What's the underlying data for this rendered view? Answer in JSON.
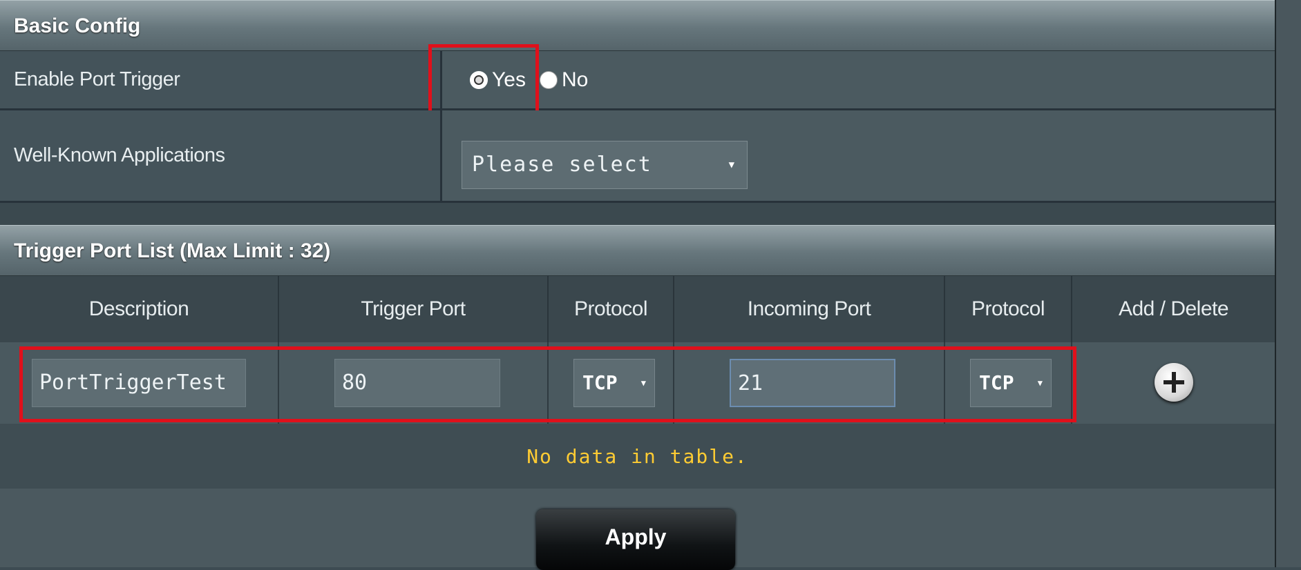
{
  "basic_config": {
    "header": "Basic Config",
    "enable_port_trigger": {
      "label": "Enable Port Trigger",
      "options": [
        "Yes",
        "No"
      ],
      "selected": "Yes"
    },
    "well_known_apps": {
      "label": "Well-Known Applications",
      "value": "Please select"
    }
  },
  "trigger_list": {
    "header": "Trigger Port List (Max Limit : 32)",
    "columns": [
      "Description",
      "Trigger Port",
      "Protocol",
      "Incoming Port",
      "Protocol",
      "Add / Delete"
    ],
    "input_row": {
      "description": "PortTriggerTest",
      "trigger_port": "80",
      "trigger_protocol": "TCP",
      "incoming_port": "21",
      "incoming_protocol": "TCP"
    },
    "empty_message": "No data in table."
  },
  "footer": {
    "apply_label": "Apply"
  },
  "colors": {
    "highlight": "#e0101b",
    "empty_text": "#ffcc33"
  },
  "icons": {
    "add": "plus-circle-icon",
    "dropdown": "caret-down-icon"
  }
}
